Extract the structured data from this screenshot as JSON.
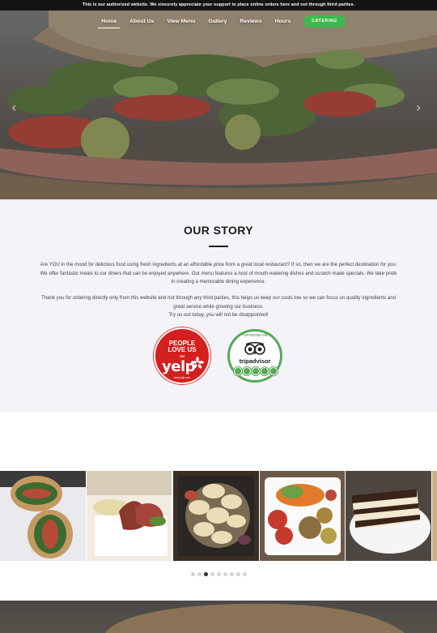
{
  "topbar": {
    "text": "This is our authorized website. We sincerely appreciate your support to place online orders here and not through third parties."
  },
  "nav": {
    "items": [
      {
        "label": "Home",
        "active": true
      },
      {
        "label": "About Us"
      },
      {
        "label": "View Menu"
      },
      {
        "label": "Gallery"
      },
      {
        "label": "Reviews"
      },
      {
        "label": "Hours"
      }
    ],
    "cta_label": "CATERING",
    "cta_color": "#3fb94f"
  },
  "hero": {
    "prev_icon": "chevron-left-icon",
    "next_icon": "chevron-right-icon"
  },
  "story": {
    "title": "OUR STORY",
    "paragraph1": "Are YOU in the mood for delicious food using fresh ingredients at an affordable price from a great local restaurant? If so, then we are the perfect destination for you. We offer fantastic meals to our diners that can be enjoyed anywhere. Our menu features a host of mouth-watering dishes and scratch made specials. We take pride in creating a memorable dining experience.",
    "paragraph2_line1": "Thank you for ordering directly only from this website and not through any third parties, this helps us keep our costs low so we can focus on quality ingredients and great service while growing our business.",
    "paragraph2_line2": "Try us out today, you will not be disappointed!"
  },
  "badges": {
    "yelp": {
      "line1": "PEOPLE",
      "line2": "LOVE US",
      "line3": "ON",
      "logo": "yelp",
      "url": "www.yelp.com",
      "color": "#d41f1f"
    },
    "tripadvisor": {
      "top": "TOP RATED ON",
      "name": "tripadvisor",
      "color": "#57a85a"
    }
  },
  "gallery": {
    "slides": 9,
    "active_slide": 3
  }
}
